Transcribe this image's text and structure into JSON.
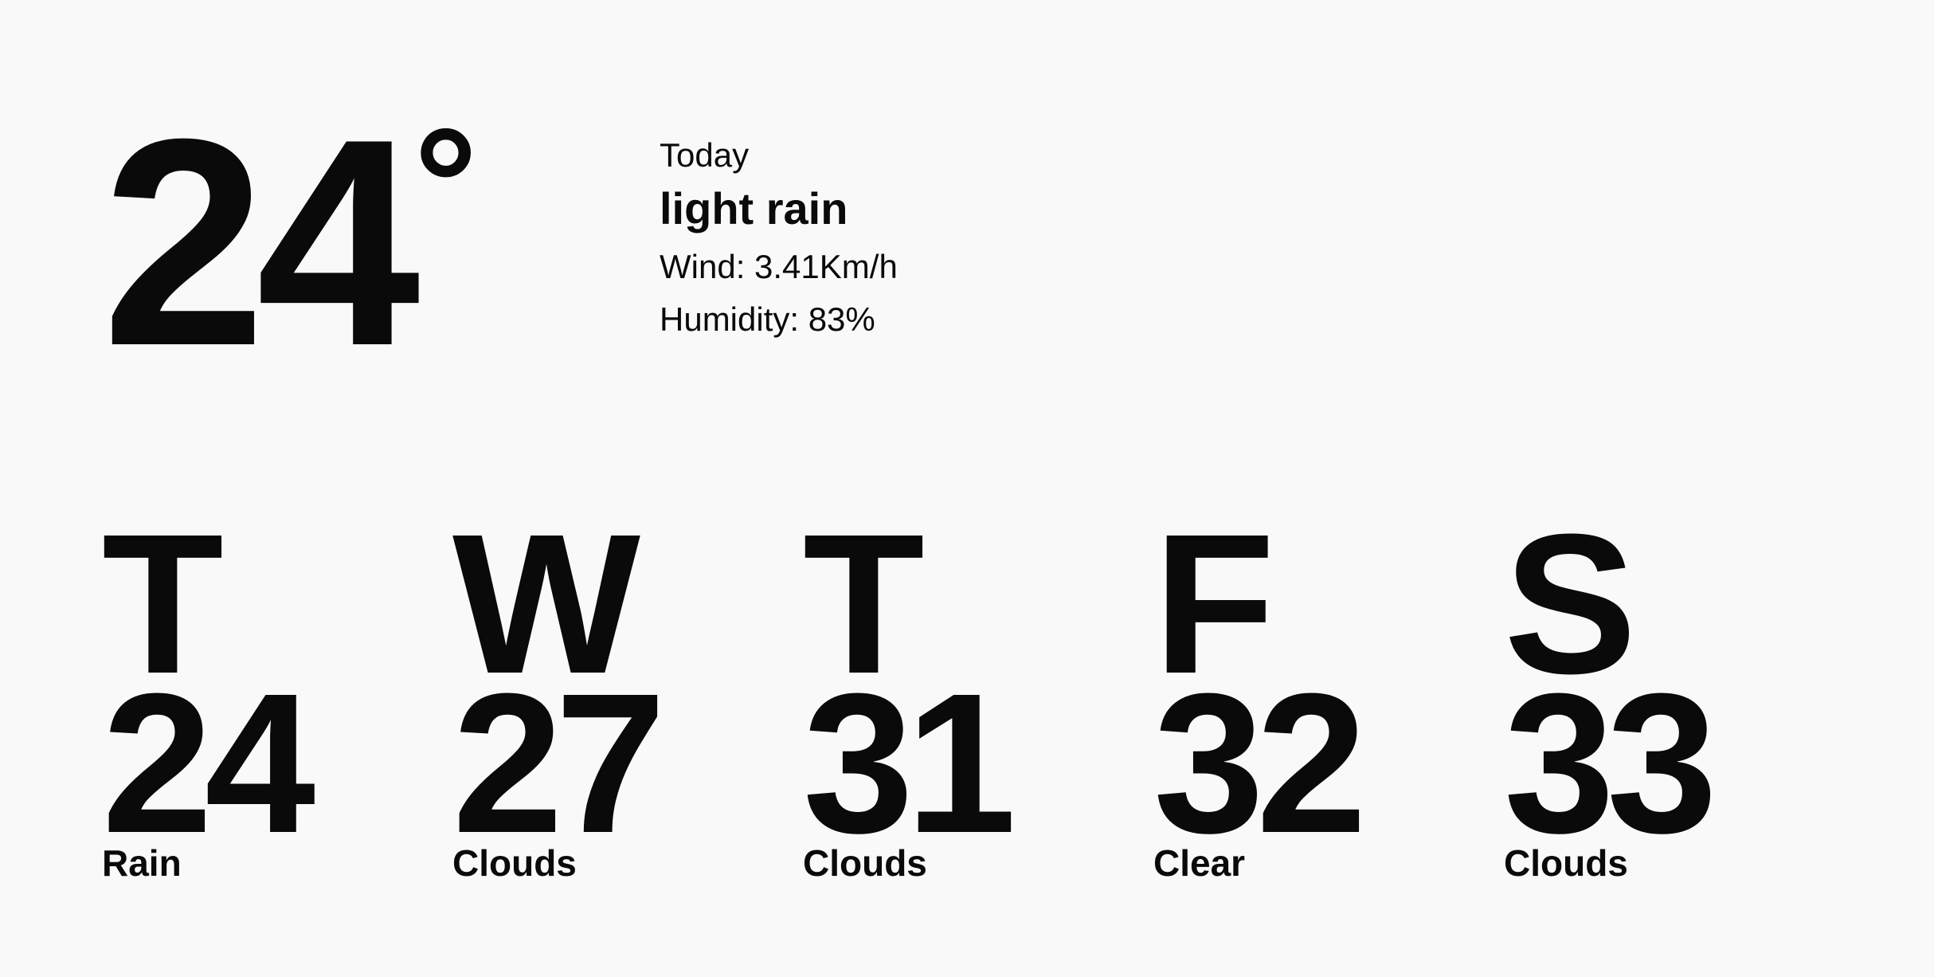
{
  "current": {
    "temperature": "24",
    "degree_symbol": "°",
    "day_label": "Today",
    "description": "light rain",
    "wind": "Wind: 3.41Km/h",
    "humidity": "Humidity: 83%"
  },
  "forecast": [
    {
      "day": "T",
      "temp": "24",
      "condition": "Rain"
    },
    {
      "day": "W",
      "temp": "27",
      "condition": "Clouds"
    },
    {
      "day": "T",
      "temp": "31",
      "condition": "Clouds"
    },
    {
      "day": "F",
      "temp": "32",
      "condition": "Clear"
    },
    {
      "day": "S",
      "temp": "33",
      "condition": "Clouds"
    }
  ]
}
